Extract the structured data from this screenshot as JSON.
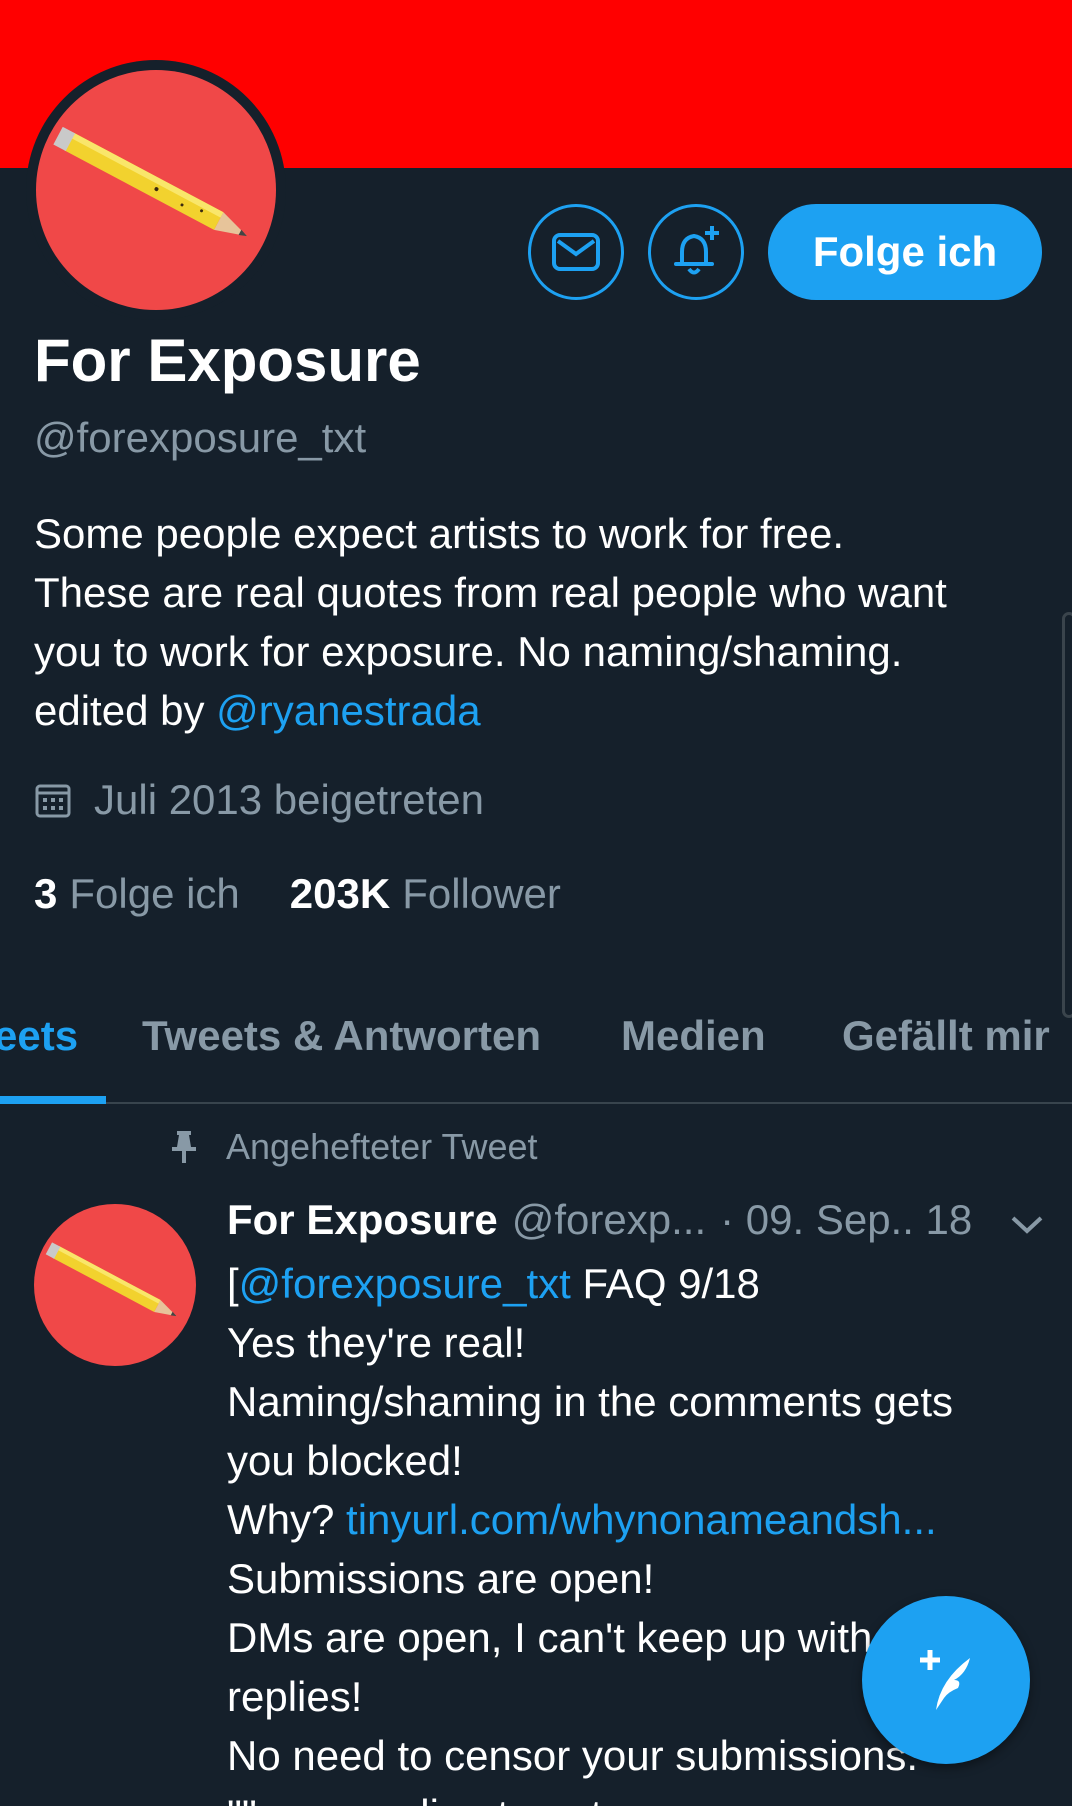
{
  "colors": {
    "banner": "#ff0000",
    "background": "#15202b",
    "accent": "#1da1f2",
    "muted_text": "#8899a6",
    "avatar_bg": "#f04848"
  },
  "profile": {
    "name": "For Exposure",
    "handle": "@forexposure_txt",
    "bio_lines": [
      "Some people expect artists to work for free.",
      "These are real quotes from real people who want",
      "you to work for exposure. No naming/shaming."
    ],
    "bio_edited_prefix": "edited by ",
    "bio_edited_link": "@ryanestrada",
    "joined": "Juli 2013 beigetreten",
    "following_count": "3",
    "following_label": "Folge ich",
    "followers_count": "203K",
    "followers_label": "Follower"
  },
  "header_actions": {
    "message_icon": "envelope-icon",
    "notify_icon": "bell-plus-icon",
    "follow_label": "Folge ich"
  },
  "tabs": [
    {
      "label": "eets",
      "active": true
    },
    {
      "label": "Tweets & Antworten",
      "active": false
    },
    {
      "label": "Medien",
      "active": false
    },
    {
      "label": "Gefällt mir",
      "active": false
    }
  ],
  "pinned_tweet": {
    "pinned_label": "Angehefteter Tweet",
    "author_name": "For Exposure",
    "author_handle": "@forexp...",
    "date": "· 09. Sep.. 18",
    "first_line_prefix": "[",
    "first_line_mention": "@forexposure_txt",
    "first_line_rest": " FAQ 9/18",
    "line_2": "Yes they're real!",
    "line_3": "Naming/shaming in the comments gets",
    "line_4": "you blocked!",
    "why_prefix": "Why? ",
    "why_link": "tinyurl.com/whynonameandsh...",
    "line_6": "Submissions are open!",
    "line_7": "DMs are open, I can't keep up with",
    "line_8": "replies!",
    "line_9": "No need to censor your submissions.",
    "line_10": "\"\" means direct quote"
  },
  "fab": {
    "icon": "compose-tweet-icon"
  }
}
